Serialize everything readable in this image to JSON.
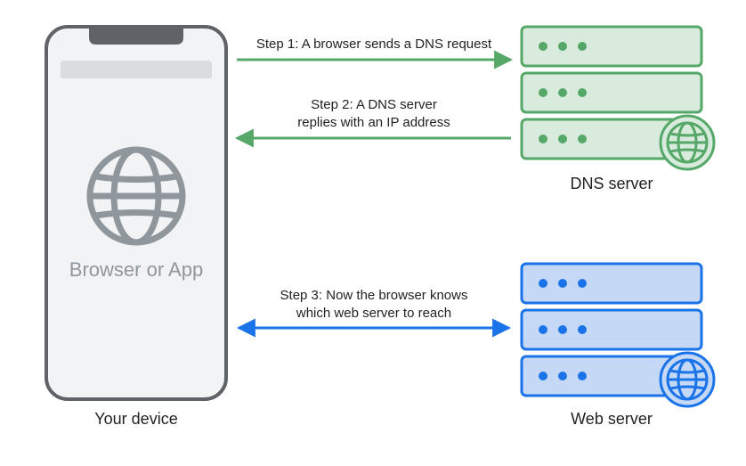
{
  "device": {
    "label": "Your device",
    "app_text": "Browser or App"
  },
  "dns_server": {
    "label": "DNS server"
  },
  "web_server": {
    "label": "Web server"
  },
  "steps": {
    "s1": "Step 1: A browser sends a DNS request",
    "s2_line1": "Step 2: A DNS server",
    "s2_line2": "replies with an IP address",
    "s3_line1": "Step 3: Now the browser knows",
    "s3_line2": "which web server to reach"
  },
  "colors": {
    "green": "#55a868",
    "blue": "#1a73e8",
    "device_stroke": "#5f6368",
    "device_fill": "#f1f3f4",
    "device_bar": "#dadce0"
  },
  "chart_data": {
    "type": "diagram",
    "nodes": [
      {
        "id": "device",
        "label": "Your device",
        "sublabel": "Browser or App"
      },
      {
        "id": "dns",
        "label": "DNS server"
      },
      {
        "id": "web",
        "label": "Web server"
      }
    ],
    "edges": [
      {
        "from": "device",
        "to": "dns",
        "label": "Step 1: A browser sends a DNS request",
        "direction": "one-way"
      },
      {
        "from": "dns",
        "to": "device",
        "label": "Step 2: A DNS server replies with an IP address",
        "direction": "one-way"
      },
      {
        "from": "device",
        "to": "web",
        "label": "Step 3: Now the browser knows which web server to reach",
        "direction": "two-way"
      }
    ]
  }
}
